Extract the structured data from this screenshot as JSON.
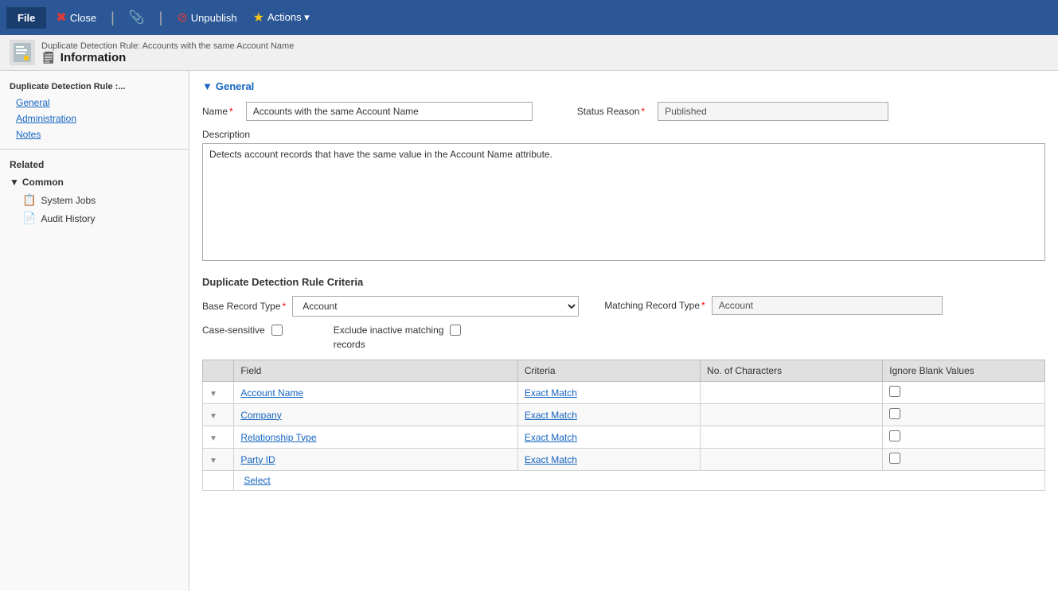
{
  "toolbar": {
    "file_label": "File",
    "close_label": "Close",
    "unpublish_label": "Unpublish",
    "actions_label": "Actions ▾",
    "close_icon": "✖",
    "unpublish_icon": "⊘",
    "actions_icon": "★",
    "paperclip_icon": "📎"
  },
  "titlebar": {
    "breadcrumb": "Duplicate Detection Rule: Accounts with the same Account Name",
    "page_title": "Information",
    "page_title_icon": "🗒"
  },
  "sidebar": {
    "section_title": "Duplicate Detection Rule :...",
    "nav_items": [
      {
        "label": "General"
      },
      {
        "label": "Administration"
      },
      {
        "label": "Notes"
      }
    ],
    "related_title": "Related",
    "group_title": "Common",
    "group_items": [
      {
        "label": "System Jobs",
        "icon": "📋"
      },
      {
        "label": "Audit History",
        "icon": "📄"
      }
    ]
  },
  "general": {
    "section_label": "General",
    "name_label": "Name",
    "name_value": "Accounts with the same Account Name",
    "status_reason_label": "Status Reason",
    "status_reason_value": "Published",
    "description_label": "Description",
    "description_value": "Detects account records that have the same value in the Account Name attribute.",
    "criteria_title": "Duplicate Detection Rule Criteria",
    "base_record_type_label": "Base Record Type",
    "base_record_type_value": "Account",
    "matching_record_type_label": "Matching Record Type",
    "matching_record_type_value": "Account",
    "case_sensitive_label": "Case-sensitive",
    "exclude_inactive_label": "Exclude inactive matching",
    "exclude_inactive_label2": "records"
  },
  "table": {
    "headers": [
      "",
      "Field",
      "Criteria",
      "No. of Characters",
      "Ignore Blank Values"
    ],
    "rows": [
      {
        "field": "Account Name",
        "criteria": "Exact Match"
      },
      {
        "field": "Company",
        "criteria": "Exact Match"
      },
      {
        "field": "Relationship Type",
        "criteria": "Exact Match"
      },
      {
        "field": "Party ID",
        "criteria": "Exact Match"
      }
    ],
    "select_label": "Select"
  }
}
